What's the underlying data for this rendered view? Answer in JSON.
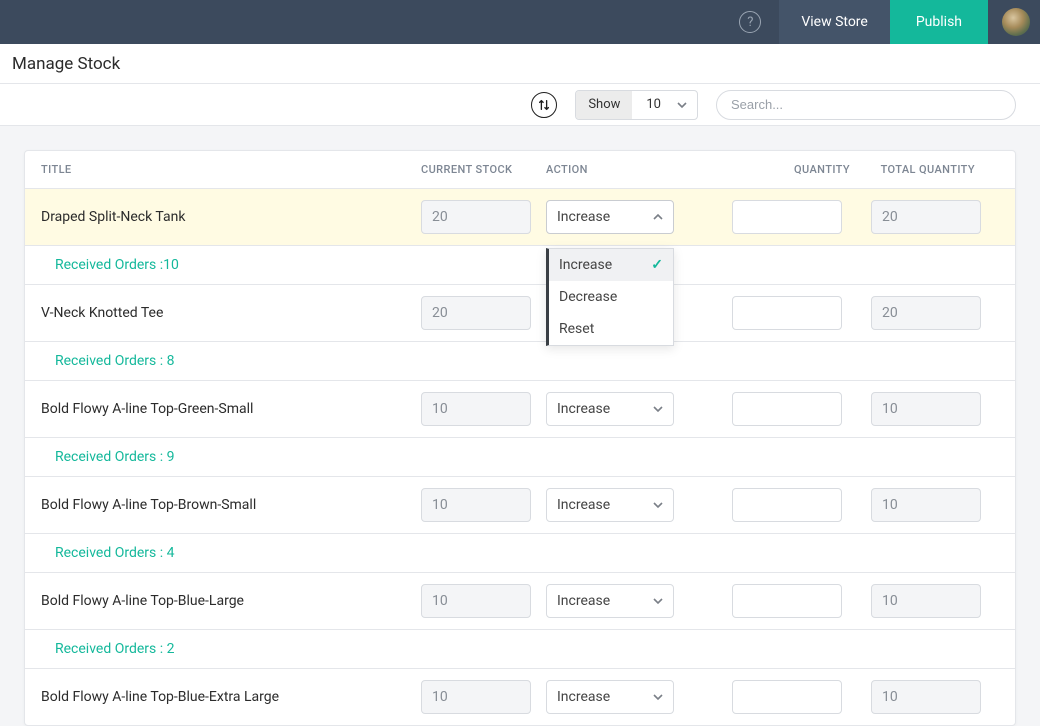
{
  "topbar": {
    "help_tooltip": "?",
    "view_store_label": "View Store",
    "publish_label": "Publish"
  },
  "page": {
    "title": "Manage Stock"
  },
  "controls": {
    "show_label": "Show",
    "show_value": "10",
    "search_placeholder": "Search..."
  },
  "table": {
    "headers": {
      "title": "TITLE",
      "current_stock": "CURRENT STOCK",
      "action": "ACTION",
      "quantity": "QUANTITY",
      "total_quantity": "TOTAL QUANTITY"
    },
    "action_options": [
      "Increase",
      "Decrease",
      "Reset"
    ],
    "rows": [
      {
        "title": "Draped Split-Neck Tank",
        "current_stock": "20",
        "action": "Increase",
        "quantity": "",
        "total": "20",
        "received": "Received Orders :10",
        "highlight": true,
        "dropdown_open": true
      },
      {
        "title": "V-Neck Knotted Tee",
        "current_stock": "20",
        "action": "Increase",
        "quantity": "",
        "total": "20",
        "received": "Received Orders : 8"
      },
      {
        "title": "Bold Flowy A-line Top-Green-Small",
        "current_stock": "10",
        "action": "Increase",
        "quantity": "",
        "total": "10",
        "received": "Received Orders : 9"
      },
      {
        "title": "Bold Flowy A-line Top-Brown-Small",
        "current_stock": "10",
        "action": "Increase",
        "quantity": "",
        "total": "10",
        "received": "Received Orders : 4"
      },
      {
        "title": "Bold Flowy A-line Top-Blue-Large",
        "current_stock": "10",
        "action": "Increase",
        "quantity": "",
        "total": "10",
        "received": "Received Orders : 2"
      },
      {
        "title": "Bold Flowy A-line Top-Blue-Extra Large",
        "current_stock": "10",
        "action": "Increase",
        "quantity": "",
        "total": "10"
      }
    ]
  }
}
